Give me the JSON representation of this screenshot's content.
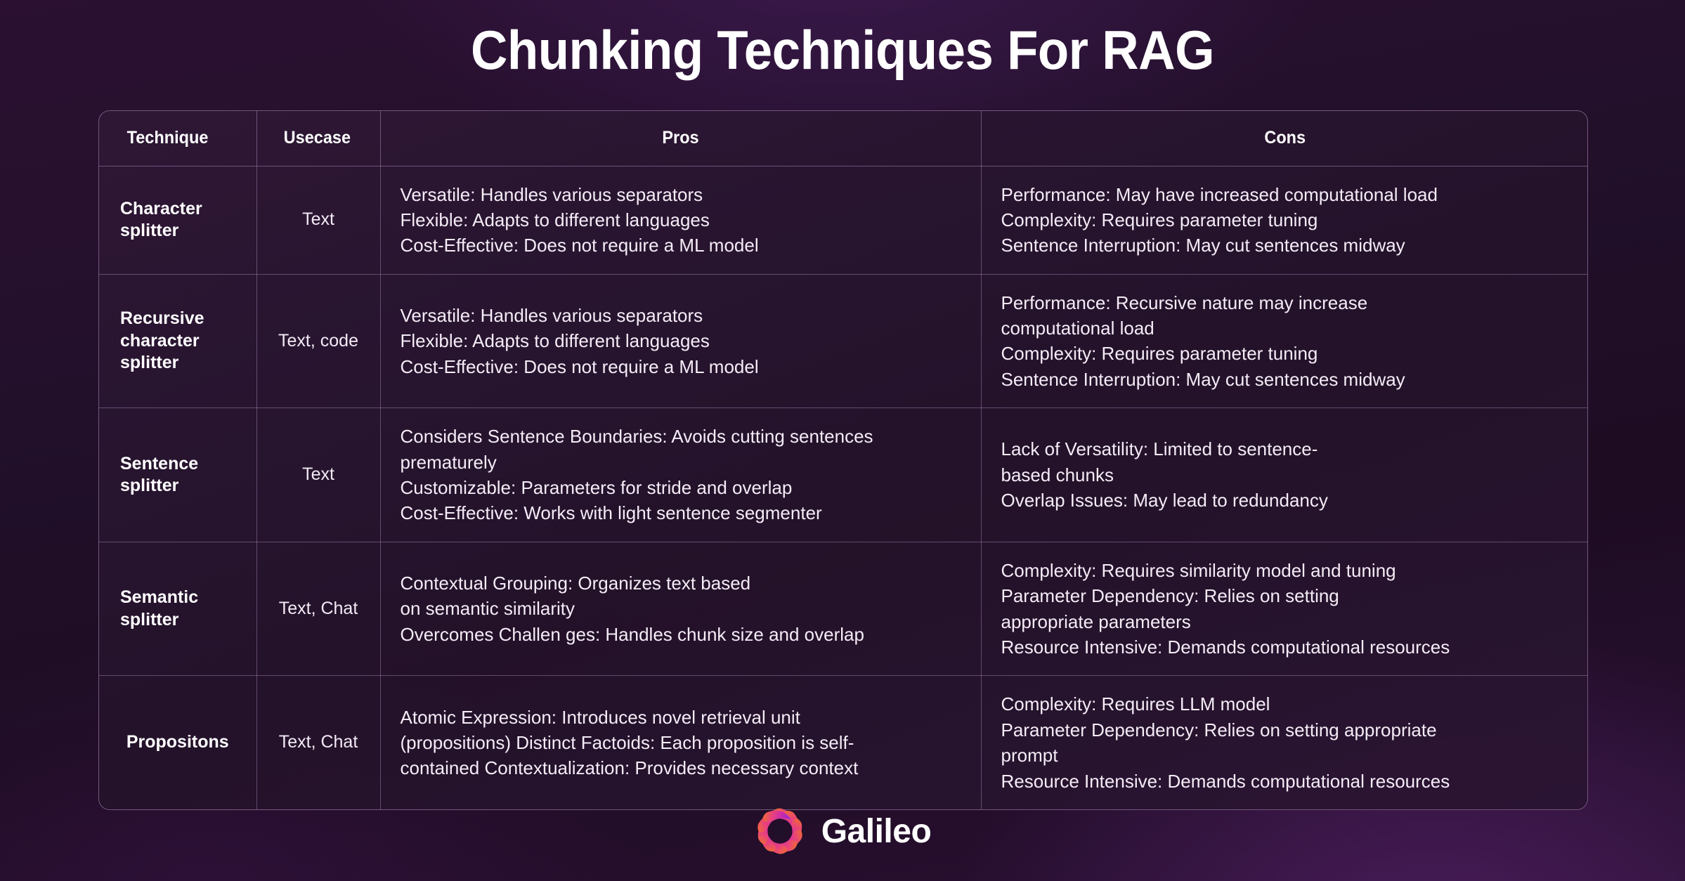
{
  "title": "Chunking Techniques For RAG",
  "table": {
    "columns": [
      {
        "key": "technique",
        "label": "Technique",
        "align": "left"
      },
      {
        "key": "usecase",
        "label": "Usecase",
        "align": "left"
      },
      {
        "key": "pros",
        "label": "Pros",
        "align": "center"
      },
      {
        "key": "cons",
        "label": "Cons",
        "align": "center"
      }
    ],
    "rows": [
      {
        "technique": "Character\nsplitter",
        "usecase": "Text",
        "pros": "Versatile: Handles various separators\nFlexible: Adapts to different languages\nCost-Effective: Does not require a ML model",
        "cons": "Performance:  May have increased computational load\nComplexity: Requires parameter tuning\nSentence Interruption: May cut sentences midway"
      },
      {
        "technique": "Recursive\ncharacter\nsplitter",
        "usecase": "Text,\ncode",
        "pros": "Versatile: Handles various separators\nFlexible: Adapts to different languages\nCost-Effective: Does not require a ML model",
        "cons": "Performance: Recursive nature may increase\ncomputational load\nComplexity: Requires parameter tuning\nSentence Interruption: May cut sentences midway"
      },
      {
        "technique": "Sentence\nsplitter",
        "usecase": "Text",
        "pros": "Considers Sentence Boundaries: Avoids cutting sentences\nprematurely\nCustomizable: Parameters for stride and overlap\nCost-Effective: Works with light sentence segmenter",
        "cons": "Lack of Versatility: Limited to sentence-\nbased chunks\nOverlap Issues: May lead to redundancy"
      },
      {
        "technique": "Semantic\nsplitter",
        "usecase": "Text,\nChat",
        "pros": "Contextual Grouping: Organizes text based\non semantic similarity\nOvercomes Challen ges: Handles chunk size and overlap",
        "cons": "Complexity: Requires similarity model and tuning\nParameter Dependency: Relies on setting\nappropriate parameters\nResource Intensive: Demands computational resources"
      },
      {
        "technique": "Propositons",
        "usecase": "Text,\nChat",
        "pros": "Atomic Expression: Introduces novel retrieval unit\n(propositions) Distinct Factoids: Each proposition is self-\ncontained Contextualization: Provides necessary context",
        "cons": "Complexity: Requires LLM model\nParameter Dependency: Relies on setting appropriate\nprompt\nResource Intensive: Demands computational resources"
      }
    ]
  },
  "footer": {
    "brand": "Galileo",
    "logo_icon": "galileo-swirl-icon",
    "logo_colors": {
      "orange": "#F2702A",
      "pink": "#E8407F",
      "magenta": "#C72AB0",
      "purple": "#8B2BD9"
    }
  },
  "theme": {
    "background_dark": "#1D0C22",
    "background_purple": "#2B1031",
    "card_background": "#241327",
    "border": "#B28EC0",
    "text": "#FFFFFF"
  }
}
